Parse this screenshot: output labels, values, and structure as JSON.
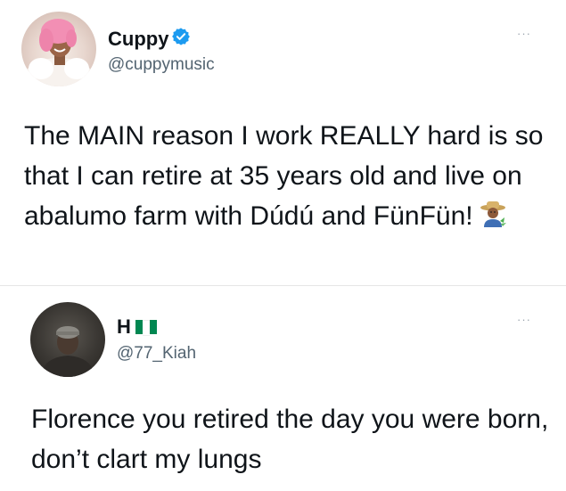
{
  "tweet": {
    "author": {
      "name": "Cuppy",
      "handle": "@cuppymusic",
      "verified": true
    },
    "text": "The MAIN reason I work REALLY hard is so that I can retire at 35 years old and live on abalumo farm with Dúdú and FünFün!",
    "emoji": "farmer-emoji",
    "menu": "···"
  },
  "reply": {
    "author": {
      "name": "H",
      "flag": "nigeria-flag-emoji",
      "handle": "@77_Kiah"
    },
    "text": "Florence you retired the day you were born, don’t clart my lungs",
    "menu": "···"
  },
  "colors": {
    "verified": "#1d9bf0",
    "handle": "#536471",
    "nigeria_green": "#008751"
  }
}
